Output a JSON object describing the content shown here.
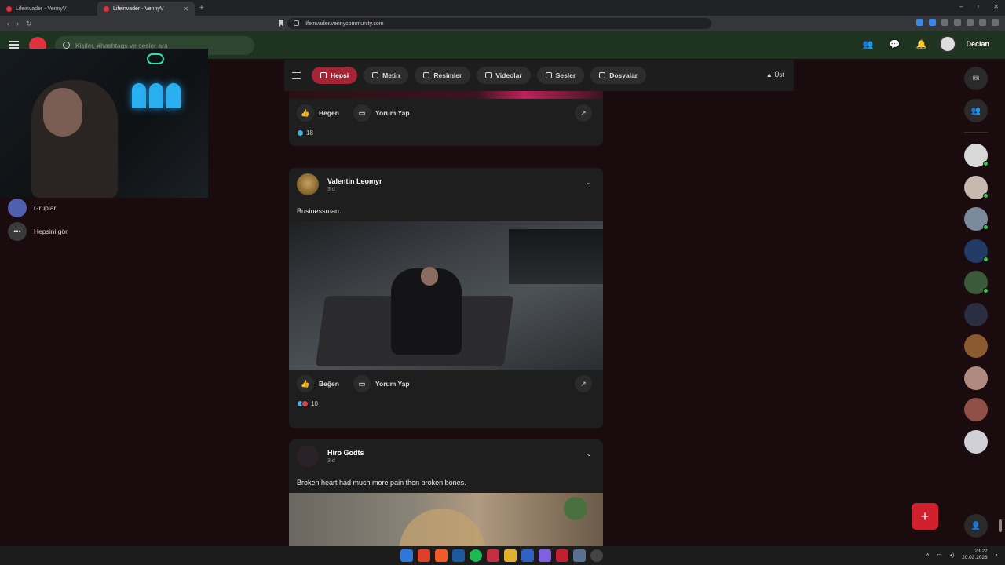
{
  "browser": {
    "tabs": [
      {
        "title": "Lifeinvader - VennyV",
        "active": false
      },
      {
        "title": "Lifeinvader - VennyV",
        "active": true
      }
    ],
    "url": "lifeinvader.vennycommunity.com"
  },
  "header": {
    "search_placeholder": "Kişiler, #hashtags ve sesler ara",
    "username": "Declan"
  },
  "leftnav": {
    "items": [
      {
        "label": "Gruplar"
      },
      {
        "label": "Hepsini gör",
        "icon": "•••"
      }
    ]
  },
  "filters": {
    "items": [
      {
        "label": "Hepsi",
        "active": true
      },
      {
        "label": "Metin"
      },
      {
        "label": "Resimler"
      },
      {
        "label": "Videolar"
      },
      {
        "label": "Sesler"
      },
      {
        "label": "Dosyalar"
      }
    ],
    "top_label": "Üst",
    "top_arrow": "▲"
  },
  "posts": [
    {
      "actions": {
        "like": "Beğen",
        "comment": "Yorum Yap"
      },
      "reaction_count": "18"
    },
    {
      "author": "Valentin Leomyr",
      "time": "3 d",
      "text": "Businessman.",
      "actions": {
        "like": "Beğen",
        "comment": "Yorum Yap"
      },
      "reaction_count": "10"
    },
    {
      "author": "Hiro Godts",
      "time": "3 d",
      "text": "Broken heart had much more pain then broken bones."
    }
  ],
  "icons": {
    "chevron": "⌄",
    "share": "↗",
    "like": "👍",
    "comment": "▭",
    "plus": "+"
  },
  "taskbar": {
    "time": "23:22",
    "date": "20.03.2026"
  },
  "colors": {
    "accent": "#a52535",
    "header": "#1e3320",
    "fab": "#d0202e",
    "online": "#35c84a"
  }
}
